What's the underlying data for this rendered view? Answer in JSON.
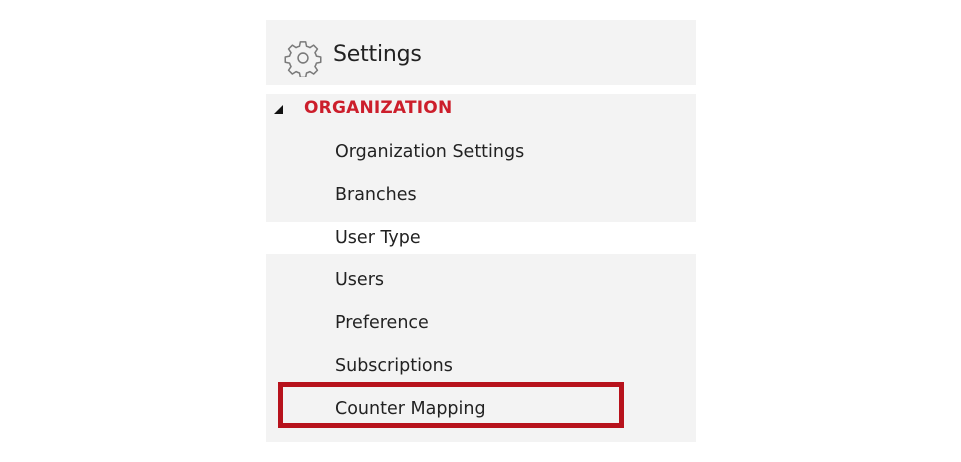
{
  "header": {
    "title": "Settings",
    "icon": "gear-icon"
  },
  "section": {
    "label": "ORGANIZATION",
    "label_color": "#cc1e2b",
    "expanded": true
  },
  "items": [
    {
      "label": "Organization Settings"
    },
    {
      "label": "Branches"
    },
    {
      "label": "User Type"
    },
    {
      "label": "Users"
    },
    {
      "label": "Preference"
    },
    {
      "label": "Subscriptions"
    },
    {
      "label": "Counter Mapping",
      "highlighted": true
    }
  ],
  "highlight_color": "#b7121c"
}
